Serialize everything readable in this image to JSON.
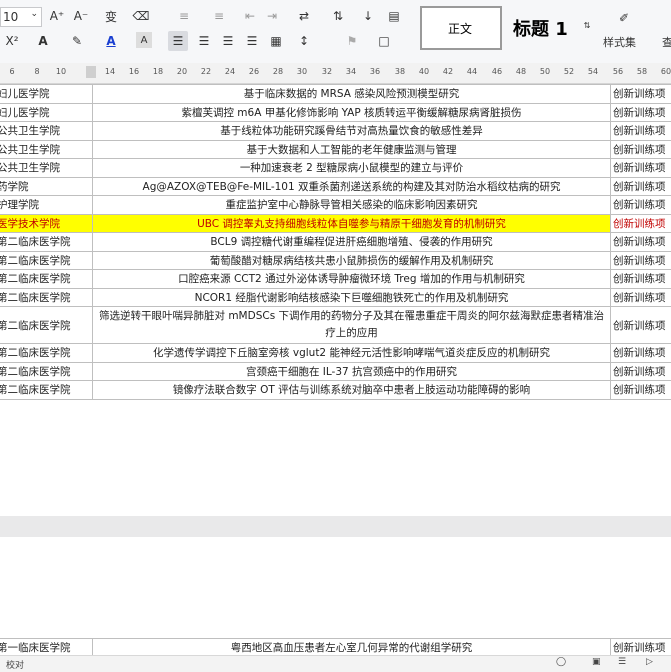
{
  "ribbon": {
    "font_size_value": "10",
    "grow_font": "A⁺",
    "shrink_font": "A⁻",
    "phonetic": "变",
    "superscript": "X²",
    "style_normal": "正文",
    "style_heading1": "标题 1",
    "style_set": "样式集",
    "find_cut": "查"
  },
  "ruler": {
    "ticks": [
      "6",
      "8",
      "10",
      "14",
      "16",
      "18",
      "20",
      "22",
      "24",
      "26",
      "28",
      "30",
      "32",
      "34",
      "36",
      "38",
      "40",
      "42",
      "44",
      "46",
      "48",
      "50",
      "52",
      "54",
      "56",
      "58",
      "60"
    ]
  },
  "table": {
    "rows": [
      {
        "college": "妇儿医学院",
        "title": "基于临床数据的 MRSA 感染风险预测模型研究",
        "type": "创新训练项"
      },
      {
        "college": "妇儿医学院",
        "title": "紫檀芙调控 m6A 甲基化修饰影响 YAP 核质转运平衡缓解糖尿病肾脏损伤",
        "type": "创新训练项"
      },
      {
        "college": "公共卫生学院",
        "title": "基于线粒体功能研究蹊骨结节对高热量饮食的敏感性差异",
        "type": "创新训练项"
      },
      {
        "college": "公共卫生学院",
        "title": "基于大数据和人工智能的老年健康监测与管理",
        "type": "创新训练项"
      },
      {
        "college": "公共卫生学院",
        "title": "一种加速衰老 2 型糖尿病小鼠模型的建立与评价",
        "type": "创新训练项"
      },
      {
        "college": "药学院",
        "title": "Ag@AZOX@TEB@Fe-MIL-101 双重杀菌剂递送系统的构建及其对防治水稻纹枯病的研究",
        "type": "创新训练项"
      },
      {
        "college": "护理学院",
        "title": "重症监护室中心静脉导管相关感染的临床影响因素研究",
        "type": "创新训练项"
      },
      {
        "college": "医学技术学院",
        "title": "UBC 调控睾丸支持细胞线粒体自噬参与精原干细胞发育的机制研究",
        "type": "创新训练项",
        "highlight": true
      },
      {
        "college": "第二临床医学院",
        "title": "BCL9 调控糖代谢重编程促进肝癌细胞增殖、侵袭的作用研究",
        "type": "创新训练项"
      },
      {
        "college": "第二临床医学院",
        "title": "葡萄酸醋对糖尿病结核共患小鼠肺损伤的缓解作用及机制研究",
        "type": "创新训练项"
      },
      {
        "college": "第二临床医学院",
        "title": "口腔癌来源 CCT2 通过外泌体诱导肿瘤微环境 Treg 增加的作用与机制研究",
        "type": "创新训练项"
      },
      {
        "college": "第二临床医学院",
        "title": "NCOR1 经脂代谢影响结核感染下巨噬细胞铁死亡的作用及机制研究",
        "type": "创新训练项"
      },
      {
        "college": "第二临床医学院",
        "title": "筛选逆转干眼叶喘异肺脏对 mMDSCs 下调作用的药物分子及其在罹患重症干周炎的阿尔兹海默症患者精准治疗上的应用",
        "type": "创新训练项",
        "wrap": true
      },
      {
        "college": "第二临床医学院",
        "title": "化学遗传学调控下丘脑室旁核 vglut2 能神经元活性影响哮喘气道炎症反应的机制研究",
        "type": "创新训练项"
      },
      {
        "college": "第二临床医学院",
        "title": "宫颈癌干细胞在 IL-37 抗宫颈癌中的作用研究",
        "type": "创新训练项"
      },
      {
        "college": "第二临床医学院",
        "title": "镜像疗法联合数字 OT 评估与训练系统对脑卒中患者上肢运动功能障碍的影响",
        "type": "创新训练项"
      }
    ],
    "next_page_row": {
      "college": "第一临床医学院",
      "title": "粤西地区高血压患者左心室几何异常的代谢组学研究",
      "type": "创新训练项"
    }
  },
  "status": {
    "left": "校对"
  }
}
